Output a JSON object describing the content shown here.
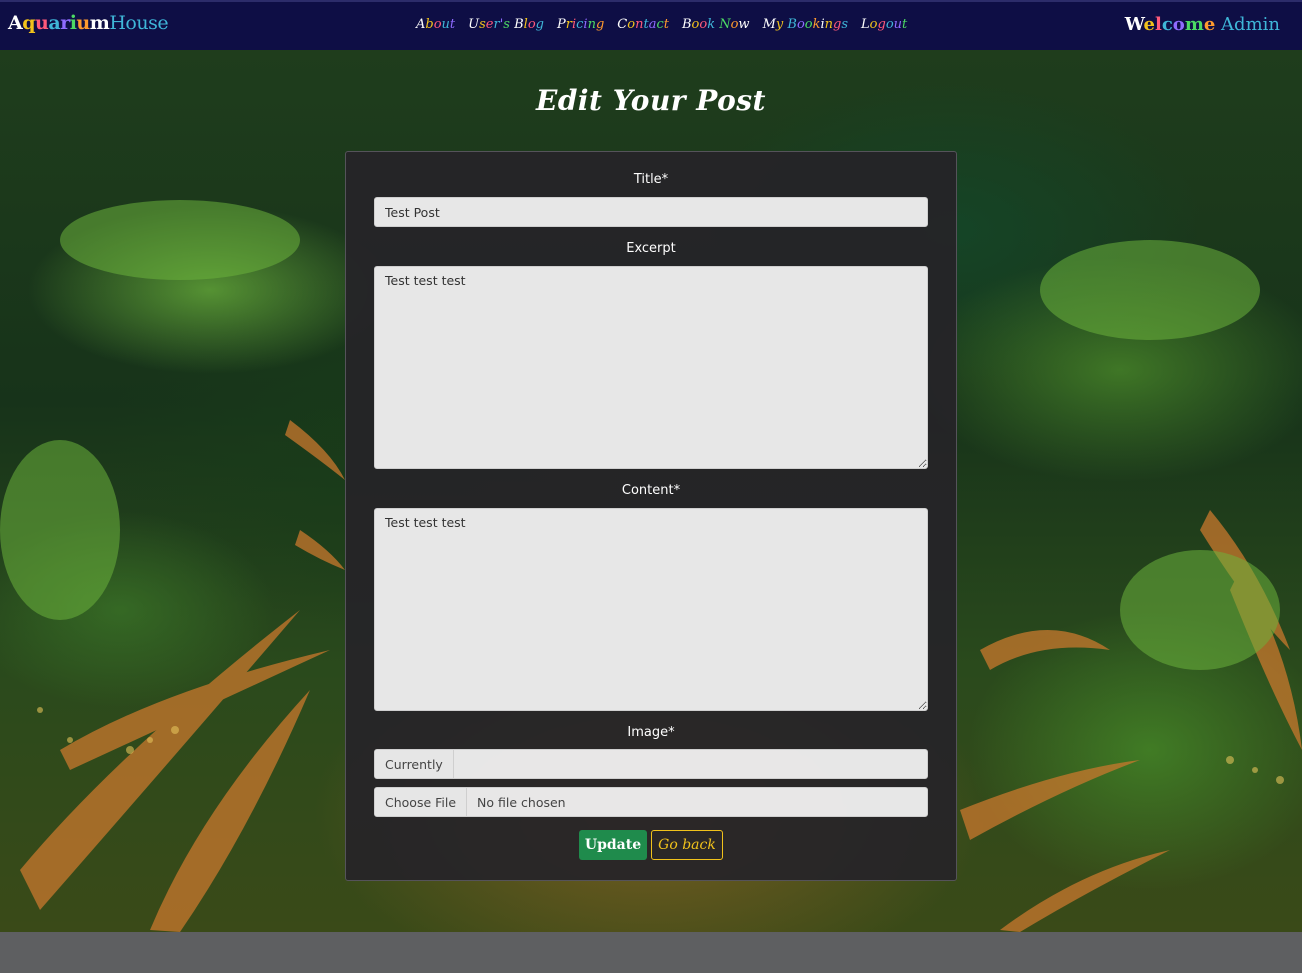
{
  "navbar": {
    "brand_part1": "Aquarium",
    "brand_part2": "House",
    "links": [
      "About",
      "User's Blog",
      "Pricing",
      "Contact",
      "Book Now",
      "My Bookings",
      "Logout"
    ],
    "welcome_label": "Welcome",
    "welcome_user": "Admin"
  },
  "page": {
    "title": "Edit Your Post"
  },
  "form": {
    "title_label": "Title*",
    "title_value": "Test Post",
    "excerpt_label": "Excerpt",
    "excerpt_value": "Test test test",
    "content_label": "Content*",
    "content_value": "Test test test",
    "image_label": "Image*",
    "currently_label": "Currently",
    "currently_value": "",
    "choose_file_label": "Choose File",
    "no_file_text": "No file chosen",
    "update_button": "Update",
    "back_button": "Go back"
  },
  "colors": {
    "navbar_bg": "#0e0e45",
    "accent_blue": "#3fb6d8",
    "update_green": "#1f8b4c",
    "back_yellow": "#f1c21b",
    "card_bg": "#262428",
    "footer_gray": "#5e5f61"
  }
}
